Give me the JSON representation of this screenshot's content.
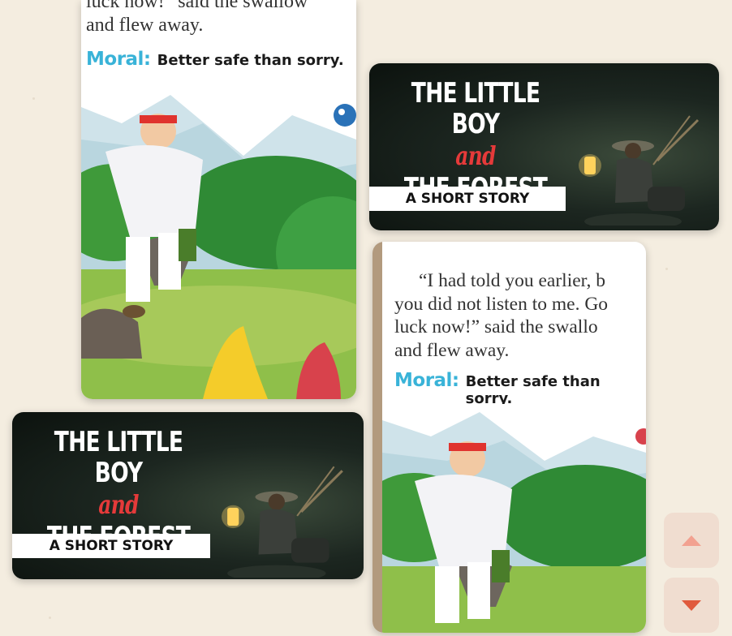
{
  "story_page_top": {
    "partial_line": "luck now!” said the swallow",
    "lines": [
      "and flew away."
    ],
    "moral_label": "Moral:",
    "moral_text": "Better safe than sorry."
  },
  "story_page_bottom": {
    "lines": [
      "“I had told you earlier, b",
      "you did not listen to me. Go",
      "luck now!” said the swallo",
      "and flew away."
    ],
    "moral_label": "Moral:",
    "moral_text": "Better safe than sorry."
  },
  "banner_top": {
    "title_line1": "THE LITTLE BOY",
    "title_and": "and",
    "title_line2": "THE FOREST",
    "subtitle": "A SHORT STORY"
  },
  "banner_bottom": {
    "title_line1": "THE LITTLE BOY",
    "title_and": "and",
    "title_line2": "THE FOREST",
    "subtitle": "A SHORT STORY"
  },
  "nav": {
    "up_icon": "chevron-up-icon",
    "down_icon": "chevron-down-icon"
  },
  "colors": {
    "background": "#f4ede0",
    "moral": "#39b3d8",
    "accent_red": "#e53a3a",
    "nav_button": "#f0ddd0",
    "nav_down_arrow": "#e05a3d"
  }
}
